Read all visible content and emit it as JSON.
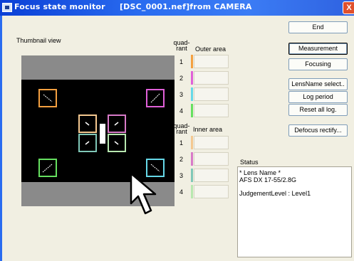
{
  "window": {
    "title": "Focus state monitor     [DSC_0001.nef]from CAMERA",
    "close_glyph": "X"
  },
  "thumbnail": {
    "label": "Thumbnail view"
  },
  "outer": {
    "quadrant_header": "quad-\nrant",
    "area_header": "Outer area",
    "rows": [
      {
        "num": "1",
        "color": "#f4a040"
      },
      {
        "num": "2",
        "color": "#e060d8"
      },
      {
        "num": "3",
        "color": "#66d8e8"
      },
      {
        "num": "4",
        "color": "#66e060"
      }
    ]
  },
  "inner": {
    "quadrant_header": "quad-\nrant",
    "area_header": "Inner area",
    "rows": [
      {
        "num": "1",
        "color": "#f4c890"
      },
      {
        "num": "2",
        "color": "#d87ac8"
      },
      {
        "num": "3",
        "color": "#80c8b8"
      },
      {
        "num": "4",
        "color": "#b8e8b0"
      }
    ]
  },
  "buttons": {
    "end": "End",
    "measurement": "Measurement",
    "focusing": "Focusing",
    "lensname_select": "LensName select..",
    "log_period": "Log period",
    "reset_all_log": "Reset all log.",
    "defocus_rectify": "Defocus rectify..."
  },
  "status": {
    "label": "Status",
    "lens_heading": "* Lens Name *",
    "lens_name": "AFS DX 17-55/2.8G",
    "judgement": "JudgementLevel : Level1"
  }
}
